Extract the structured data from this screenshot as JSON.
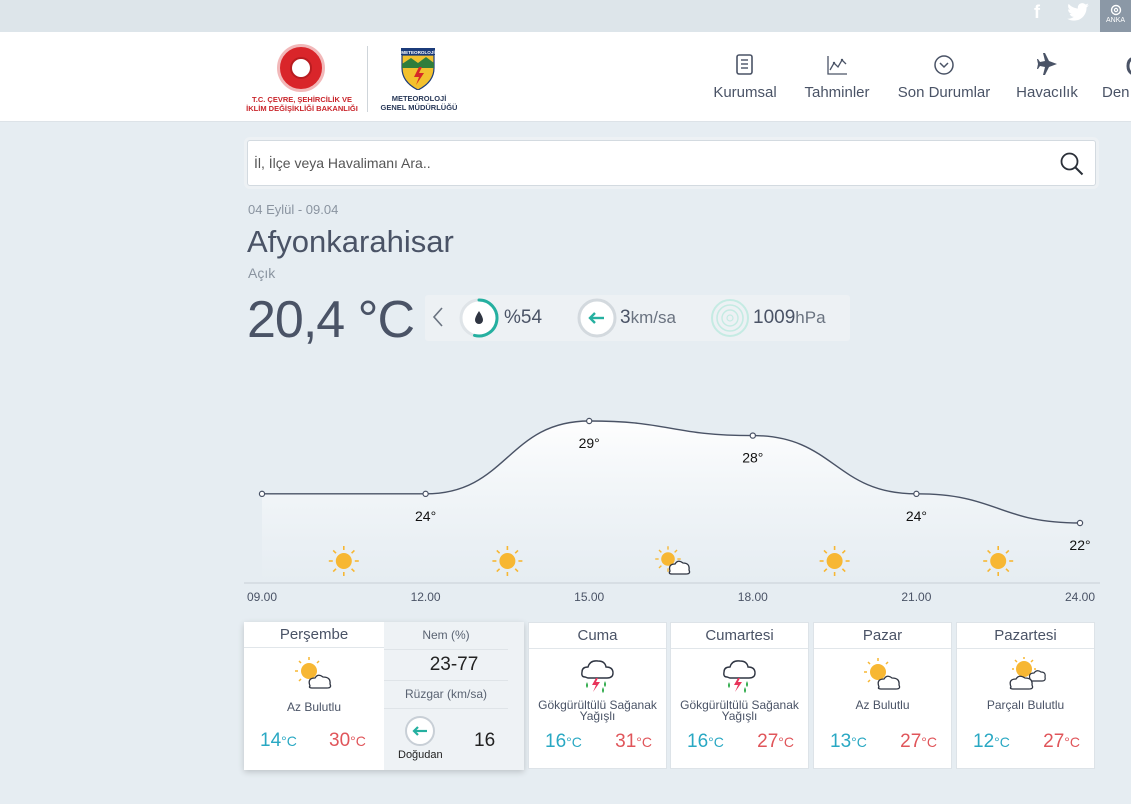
{
  "topbar": {
    "social": [
      "facebook-icon",
      "twitter-icon"
    ],
    "facebook_glyph": "f",
    "region_label": "ANKA"
  },
  "logos": {
    "ministry": "T.C. ÇEVRE, ŞEHİRCİLİK VE İKLİM DEĞİŞİKLİĞİ BAKANLIĞI",
    "ministry_line1": "T.C. ÇEVRE, ŞEHİRCİLİK VE",
    "ministry_line2": "İKLİM DEĞİŞİKLİĞİ BAKANLIĞI",
    "mgm_badge": "METEOROLOJİ",
    "mgm_line1": "METEOROLOJİ",
    "mgm_line2": "GENEL MÜDÜRLÜĞÜ"
  },
  "nav": [
    {
      "label": "Kurumsal",
      "icon": "document-icon"
    },
    {
      "label": "Tahminler",
      "icon": "forecast-chart-icon"
    },
    {
      "label": "Son Durumlar",
      "icon": "chevron-circle-icon"
    },
    {
      "label": "Havacılık",
      "icon": "airplane-icon"
    },
    {
      "label": "Den",
      "icon": "sea-icon"
    }
  ],
  "search": {
    "placeholder": "İl, İlçe veya Havalimanı Ara.."
  },
  "current": {
    "date": "04 Eylül - 09.04",
    "city": "Afyonkarahisar",
    "condition": "Açık",
    "temperature": "20,4 °C",
    "humidity": "%54",
    "humidity_pct": 54,
    "wind_value": "3",
    "wind_unit": "km/sa",
    "pressure_value": "1009",
    "pressure_unit": "hPa"
  },
  "chart_data": {
    "type": "line",
    "x": [
      "09.00",
      "12.00",
      "15.00",
      "18.00",
      "21.00",
      "24.00"
    ],
    "values": [
      24,
      24,
      29,
      28,
      24,
      22
    ],
    "labels": [
      "",
      "24°",
      "29°",
      "28°",
      "24°",
      "22°"
    ],
    "icons": [
      "sun-icon",
      "sun-icon",
      "sun-cloud-icon",
      "sun-icon",
      "sun-icon"
    ],
    "colors": {
      "line": "#4a5366",
      "fill_top": "#ffffff",
      "fill_bottom": "#e6edf2",
      "sun": "#f7b733"
    }
  },
  "today": {
    "day": "Perşembe",
    "condition": "Az Bulutlu",
    "icon": "sun-cloud-icon",
    "min": "14",
    "max": "30",
    "unit": "°C",
    "humidity_label": "Nem (%)",
    "humidity_range": "23-77",
    "wind_label": "Rüzgar (km/sa)",
    "wind_dir": "Doğudan",
    "wind_speed": "16"
  },
  "days": [
    {
      "day": "Cuma",
      "condition": "Gökgürültülü Sağanak Yağışlı",
      "icon": "thunderstorm-icon",
      "min": "16",
      "max": "31",
      "unit": "°C"
    },
    {
      "day": "Cumartesi",
      "condition": "Gökgürültülü Sağanak Yağışlı",
      "icon": "thunderstorm-icon",
      "min": "16",
      "max": "27",
      "unit": "°C"
    },
    {
      "day": "Pazar",
      "condition": "Az Bulutlu",
      "icon": "sun-cloud-icon",
      "min": "13",
      "max": "27",
      "unit": "°C"
    },
    {
      "day": "Pazartesi",
      "condition": "Parçalı Bulutlu",
      "icon": "partly-cloudy-icon",
      "min": "12",
      "max": "27",
      "unit": "°C"
    }
  ]
}
